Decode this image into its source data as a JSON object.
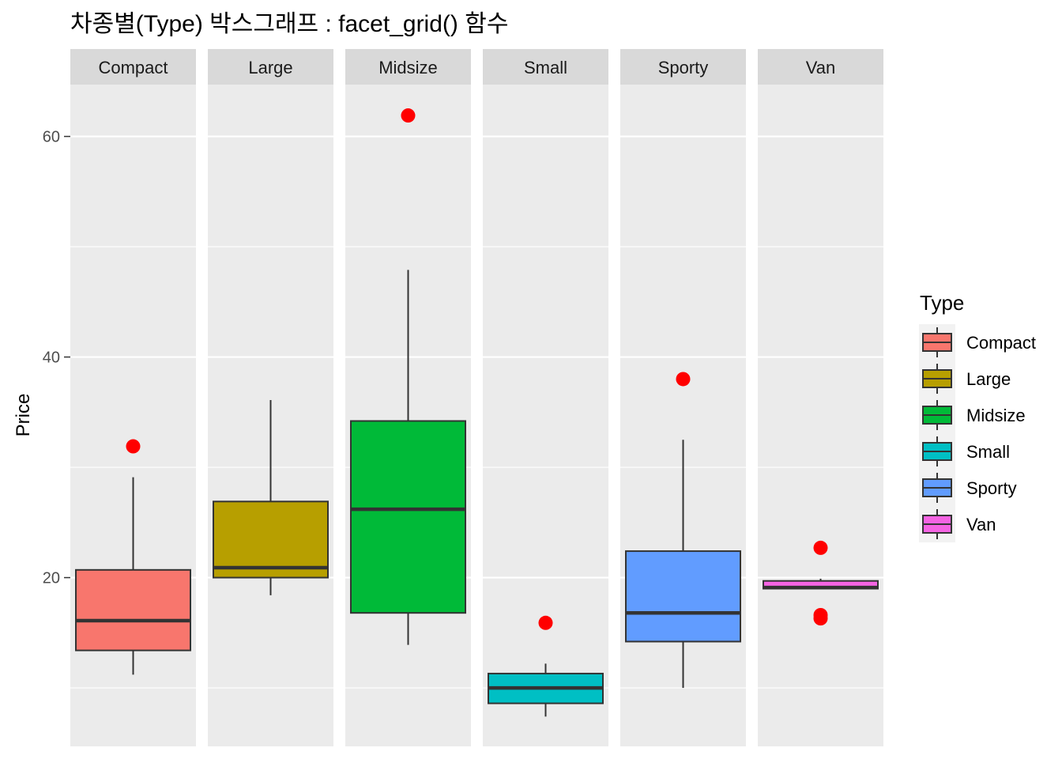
{
  "chart_data": {
    "type": "boxplot",
    "title": "차종별(Type) 박스그래프 : facet_grid() 함수",
    "xlabel": "",
    "ylabel": "Price",
    "ylim": [
      4.7,
      64.7
    ],
    "y_ticks": [
      20,
      40,
      60
    ],
    "y_minor_gridlines": [
      10,
      30,
      50
    ],
    "grid": true,
    "facets": [
      "Compact",
      "Large",
      "Midsize",
      "Small",
      "Sporty",
      "Van"
    ],
    "outlier_color": "#FF0000",
    "series": [
      {
        "name": "Compact",
        "color": "#F8766D",
        "whisker_low": 11.2,
        "q1": 13.4,
        "median": 16.1,
        "q3": 20.7,
        "whisker_high": 29.1,
        "outliers": [
          31.9
        ]
      },
      {
        "name": "Large",
        "color": "#B79F00",
        "whisker_low": 18.4,
        "q1": 20.0,
        "median": 20.9,
        "q3": 26.9,
        "whisker_high": 36.1,
        "outliers": []
      },
      {
        "name": "Midsize",
        "color": "#00BA38",
        "whisker_low": 13.9,
        "q1": 16.8,
        "median": 26.2,
        "q3": 34.2,
        "whisker_high": 47.9,
        "outliers": [
          61.9
        ]
      },
      {
        "name": "Small",
        "color": "#00BFC4",
        "whisker_low": 7.4,
        "q1": 8.6,
        "median": 10.0,
        "q3": 11.3,
        "whisker_high": 12.2,
        "outliers": [
          15.9
        ]
      },
      {
        "name": "Sporty",
        "color": "#619CFF",
        "whisker_low": 10.0,
        "q1": 14.2,
        "median": 16.8,
        "q3": 22.4,
        "whisker_high": 32.5,
        "outliers": [
          38.0
        ]
      },
      {
        "name": "Van",
        "color": "#F564E3",
        "whisker_low": 19.0,
        "q1": 19.0,
        "median": 19.1,
        "q3": 19.7,
        "whisker_high": 19.9,
        "outliers": [
          22.7,
          16.6,
          16.3
        ]
      }
    ],
    "legend": {
      "title": "Type",
      "position": "right",
      "items": [
        "Compact",
        "Large",
        "Midsize",
        "Small",
        "Sporty",
        "Van"
      ]
    }
  }
}
